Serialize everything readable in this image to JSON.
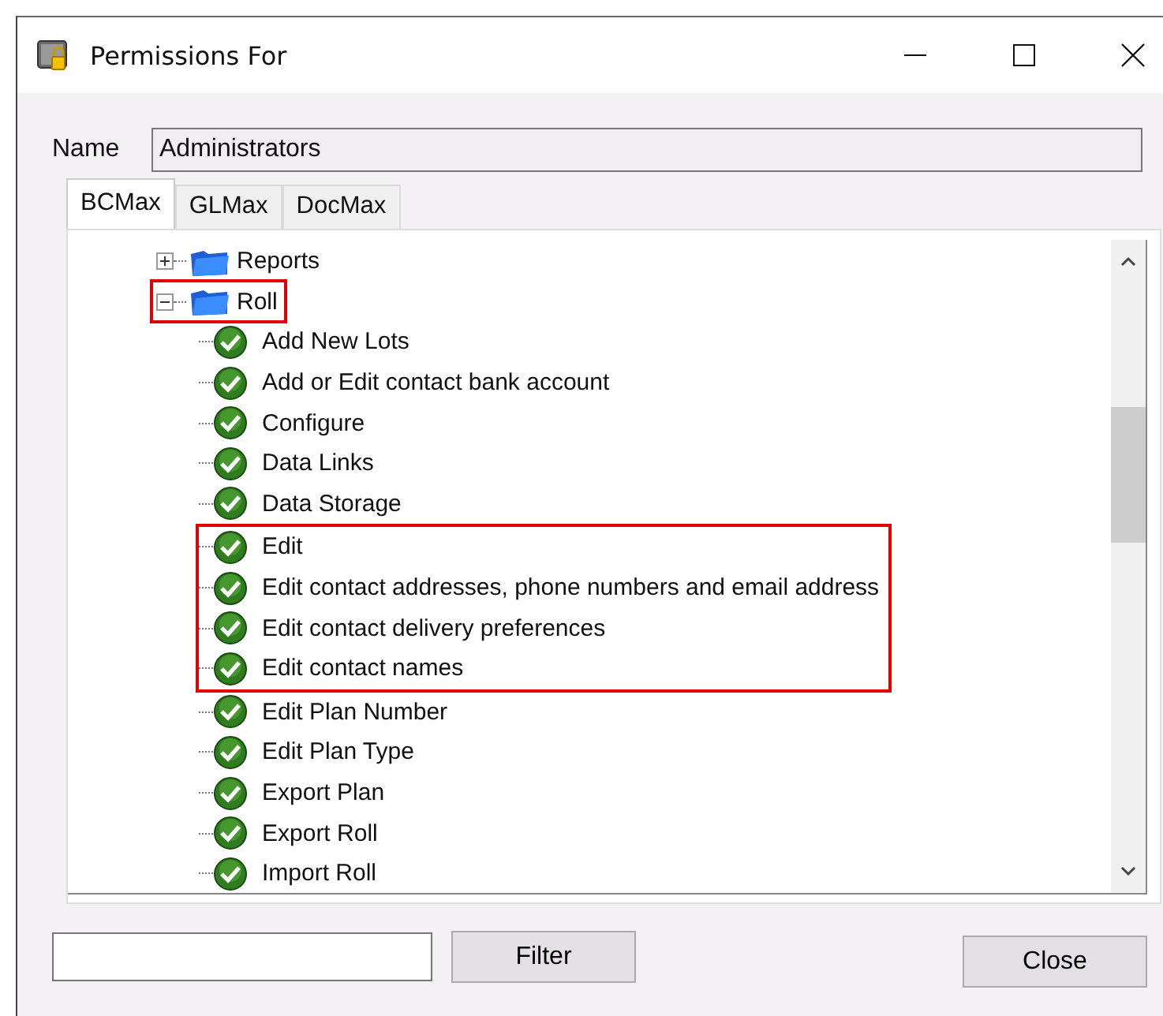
{
  "window": {
    "title": "Permissions For"
  },
  "name_field": {
    "label": "Name",
    "value": "Administrators"
  },
  "tabs": [
    {
      "label": "BCMax",
      "selected": true
    },
    {
      "label": "GLMax",
      "selected": false
    },
    {
      "label": "DocMax",
      "selected": false
    }
  ],
  "tree": [
    {
      "label": "Reports",
      "expanded": false,
      "highlighted": false
    },
    {
      "label": "Roll",
      "expanded": true,
      "highlighted": true,
      "children": [
        {
          "label": "Add New Lots",
          "highlighted": false
        },
        {
          "label": "Add or Edit contact bank account",
          "highlighted": false
        },
        {
          "label": "Configure",
          "highlighted": false
        },
        {
          "label": "Data Links",
          "highlighted": false
        },
        {
          "label": "Data Storage",
          "highlighted": false
        },
        {
          "label": "Edit",
          "highlighted": true
        },
        {
          "label": "Edit contact addresses, phone numbers and email address",
          "highlighted": true
        },
        {
          "label": "Edit contact delivery preferences",
          "highlighted": true
        },
        {
          "label": "Edit contact names",
          "highlighted": true
        },
        {
          "label": "Edit Plan Number",
          "highlighted": false
        },
        {
          "label": "Edit Plan Type",
          "highlighted": false
        },
        {
          "label": "Export Plan",
          "highlighted": false
        },
        {
          "label": "Export Roll",
          "highlighted": false
        },
        {
          "label": "Import Roll",
          "highlighted": false
        }
      ]
    }
  ],
  "filter": {
    "button": "Filter"
  },
  "buttons": [
    "Close"
  ]
}
